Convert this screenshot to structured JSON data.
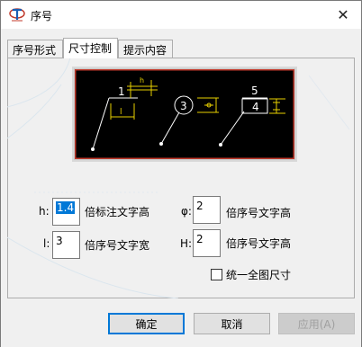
{
  "window": {
    "title": "序号",
    "close_symbol": "✕"
  },
  "tabs": [
    {
      "label": "序号形式",
      "active": false
    },
    {
      "label": "尺寸控制",
      "active": true
    },
    {
      "label": "提示内容",
      "active": false
    }
  ],
  "preview": {
    "label_1": "1",
    "label_h": "h",
    "label_l": "l",
    "label_3": "3",
    "label_5": "5",
    "label_4": "4",
    "colors": {
      "background": "#000000",
      "border": "#c0392b",
      "line": "#ffffff",
      "dim": "#e8d000"
    }
  },
  "fields": {
    "h": {
      "label": "h:",
      "value": "1.4",
      "desc": "倍标注文字高"
    },
    "l": {
      "label": "l:",
      "value": "3",
      "desc": "倍序号文字宽"
    },
    "phi": {
      "label": "φ:",
      "value": "2",
      "desc": "倍序号文字高"
    },
    "H": {
      "label": "H:",
      "value": "2",
      "desc": "倍序号文字高"
    }
  },
  "checkbox": {
    "label": "统一全图尺寸",
    "checked": false
  },
  "buttons": {
    "ok": "确定",
    "cancel": "取消",
    "apply": "应用(A)"
  }
}
